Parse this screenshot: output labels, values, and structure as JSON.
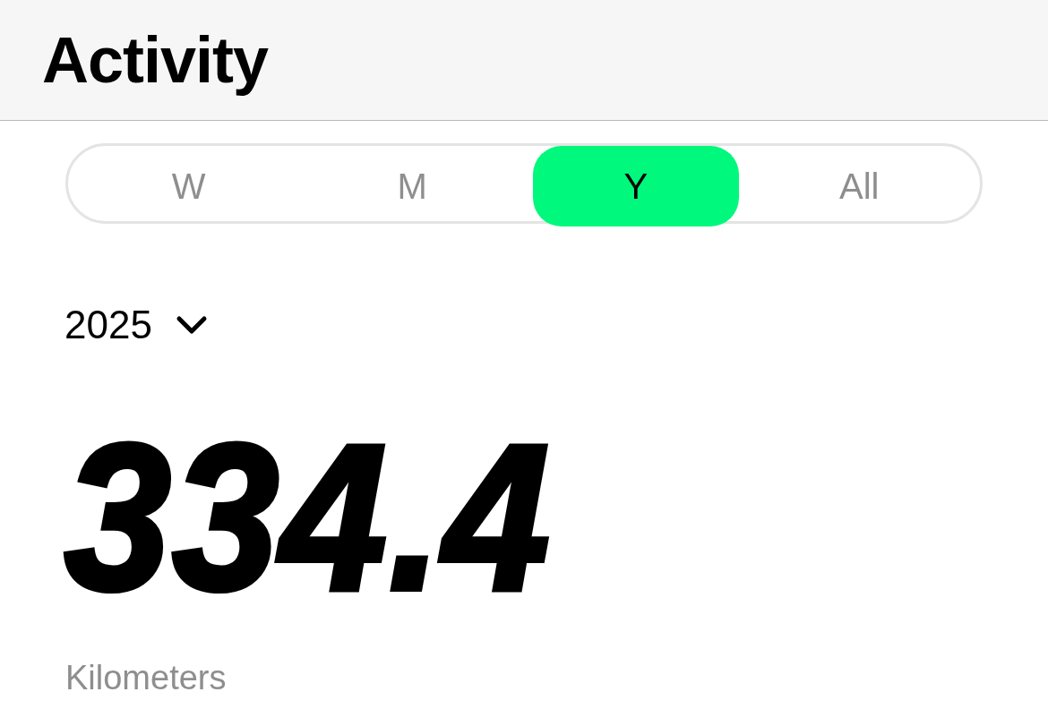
{
  "header": {
    "title": "Activity"
  },
  "tabs": [
    {
      "label": "W",
      "selected": false
    },
    {
      "label": "M",
      "selected": false
    },
    {
      "label": "Y",
      "selected": true
    },
    {
      "label": "All",
      "selected": false
    }
  ],
  "period": {
    "label": "2025"
  },
  "total": {
    "value": "334.4",
    "unit": "Kilometers"
  }
}
